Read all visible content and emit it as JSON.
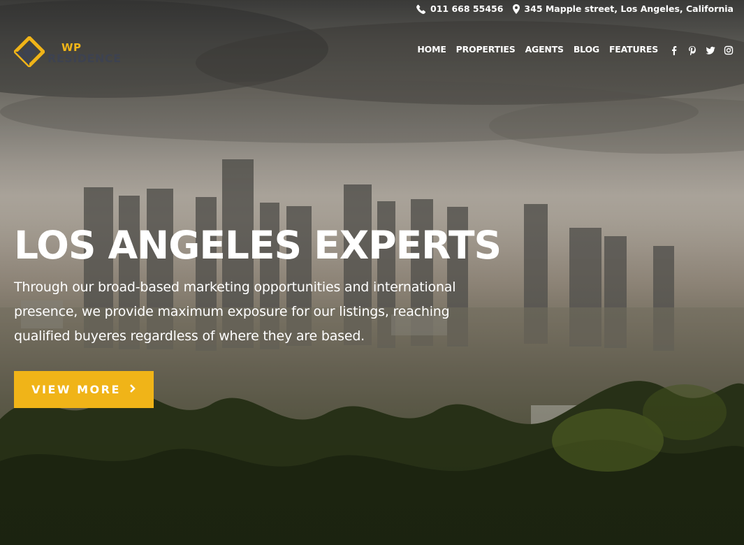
{
  "topbar": {
    "phone": "011 668 55456",
    "address": "345 Mapple street, Los Angeles, California",
    "phone_icon": "phone-icon",
    "address_icon": "map-marker-icon"
  },
  "logo": {
    "line1": "WP",
    "line2": "RESIDENCE"
  },
  "nav": {
    "items": [
      "HOME",
      "PROPERTIES",
      "AGENTS",
      "BLOG",
      "FEATURES"
    ],
    "social_icons": [
      "facebook-icon",
      "pinterest-icon",
      "twitter-icon",
      "instagram-icon"
    ]
  },
  "hero": {
    "headline": "LOS ANGELES EXPERTS",
    "lead": "Through our broad-based marketing opportunities and international presence, we provide maximum exposure for our listings, reaching qualified buyeres regardless of where they are based.",
    "cta_label": "VIEW MORE"
  },
  "colors": {
    "accent": "#f0b418",
    "logo_dark": "#3d4250",
    "text": "#ffffff"
  }
}
